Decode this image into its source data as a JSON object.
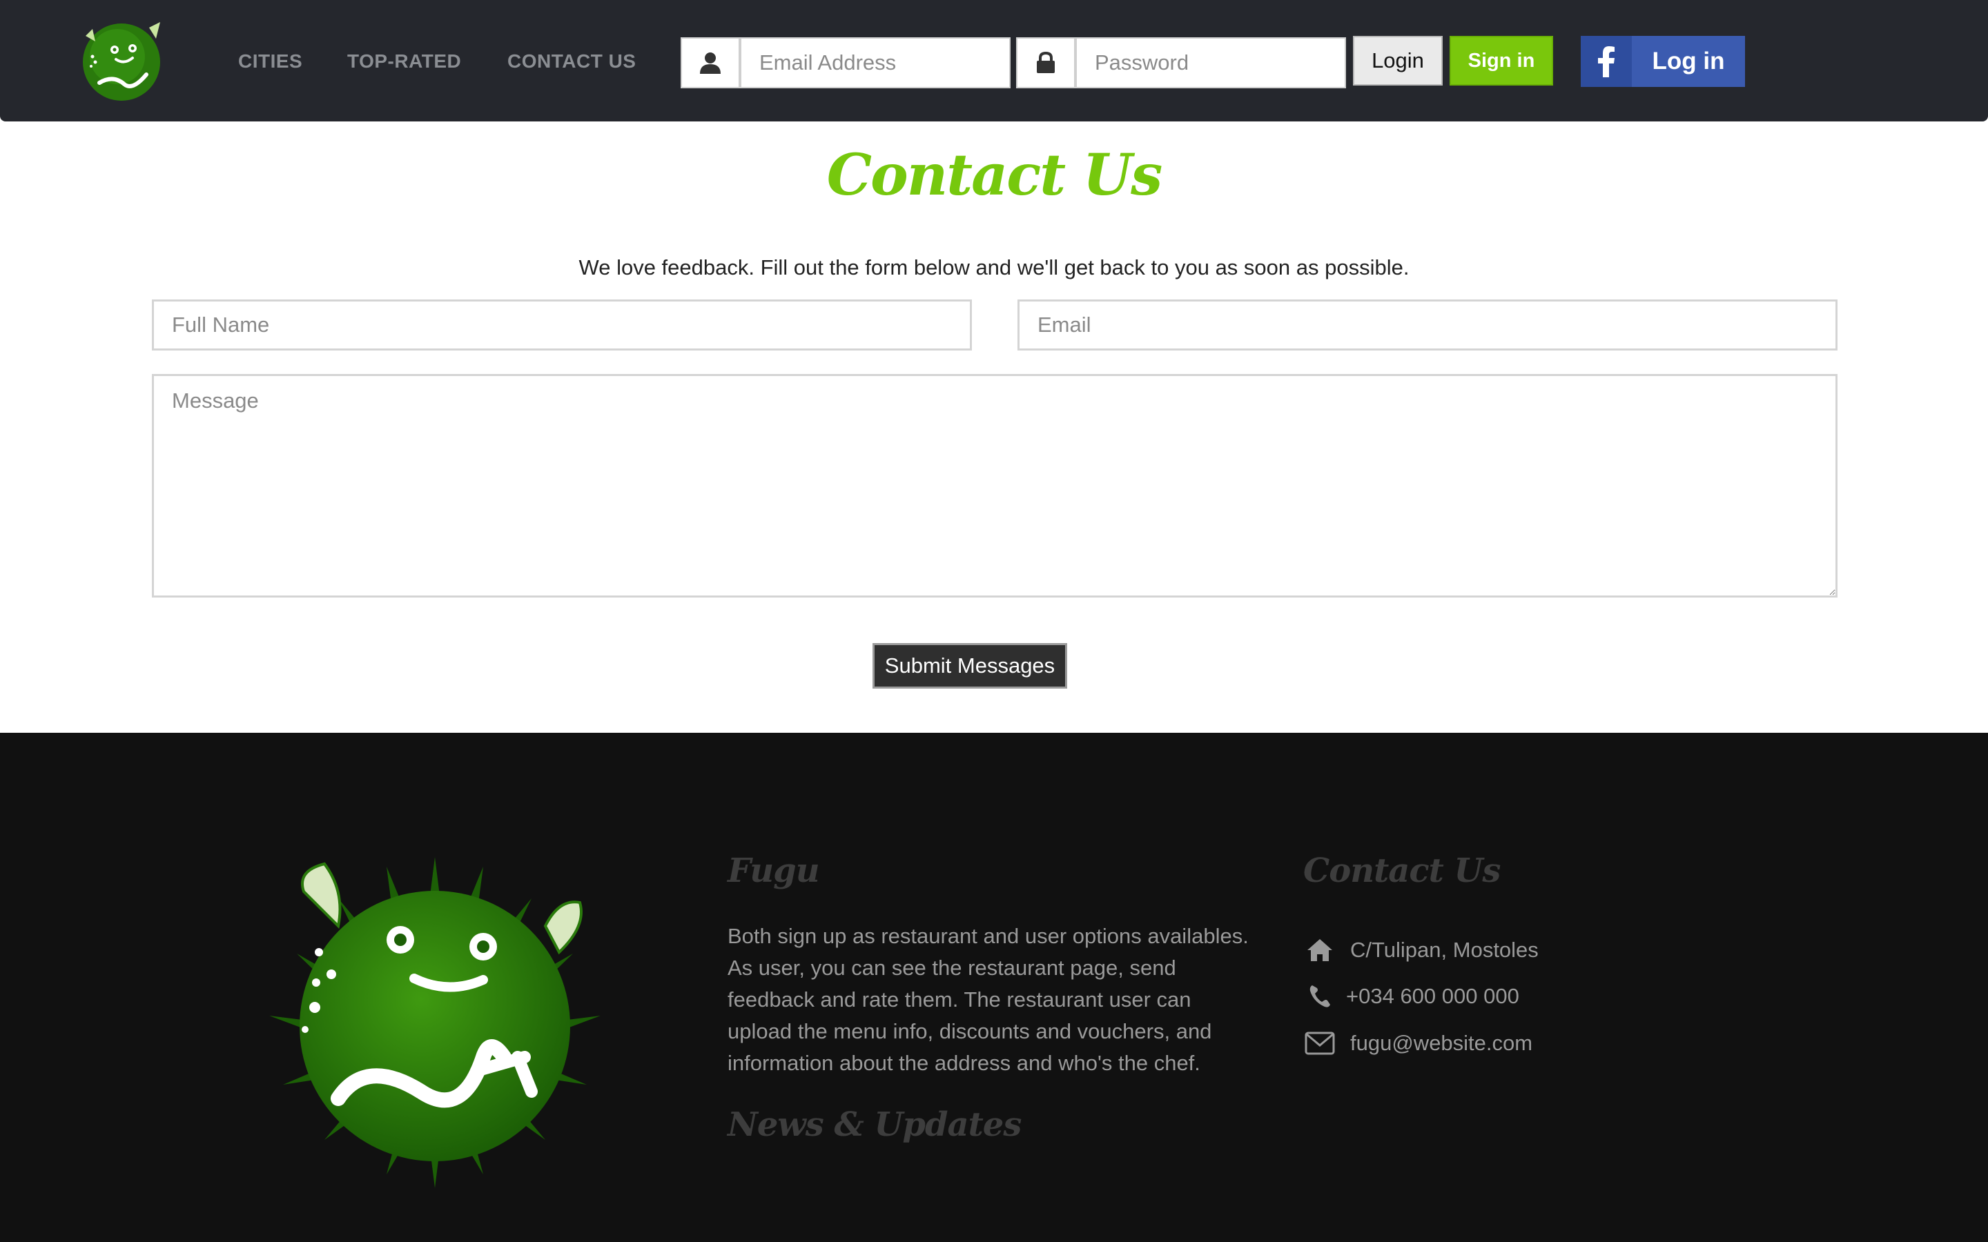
{
  "header": {
    "logo_alt": "Fugu",
    "nav": [
      {
        "label": "CITIES"
      },
      {
        "label": "TOP-RATED"
      },
      {
        "label": "CONTACT US"
      }
    ],
    "login_form": {
      "email_placeholder": "Email Address",
      "password_placeholder": "Password",
      "login_label": "Login",
      "signin_label": "Sign in",
      "facebook_label": "Log in"
    }
  },
  "main": {
    "title": "Contact Us",
    "intro": "We love feedback. Fill out the form below and we'll get back to you as soon as possible.",
    "form": {
      "name_placeholder": "Full Name",
      "email_placeholder": "Email",
      "message_placeholder": "Message",
      "submit_label": "Submit Messages"
    }
  },
  "footer": {
    "logo_alt": "Fugu",
    "about": {
      "heading": "Fugu",
      "text": "Both sign up as restaurant and user options availables. As user, you can see the restaurant page, send feedback and rate them. The restaurant user can upload the menu info, discounts and vouchers, and information about the address and who's the chef."
    },
    "news_heading": "News & Updates",
    "contact": {
      "heading": "Contact Us",
      "address": "C/Tulipan, Mostoles",
      "phone": "+034 600 000 000",
      "email": "fugu@website.com"
    }
  },
  "colors": {
    "navbar_bg": "#25272d",
    "accent_green": "#76c80d",
    "facebook_blue": "#3b5bb0",
    "footer_bg": "#111111"
  },
  "icons": [
    "user-icon",
    "lock-icon",
    "facebook-icon",
    "home-icon",
    "phone-icon",
    "envelope-icon"
  ]
}
